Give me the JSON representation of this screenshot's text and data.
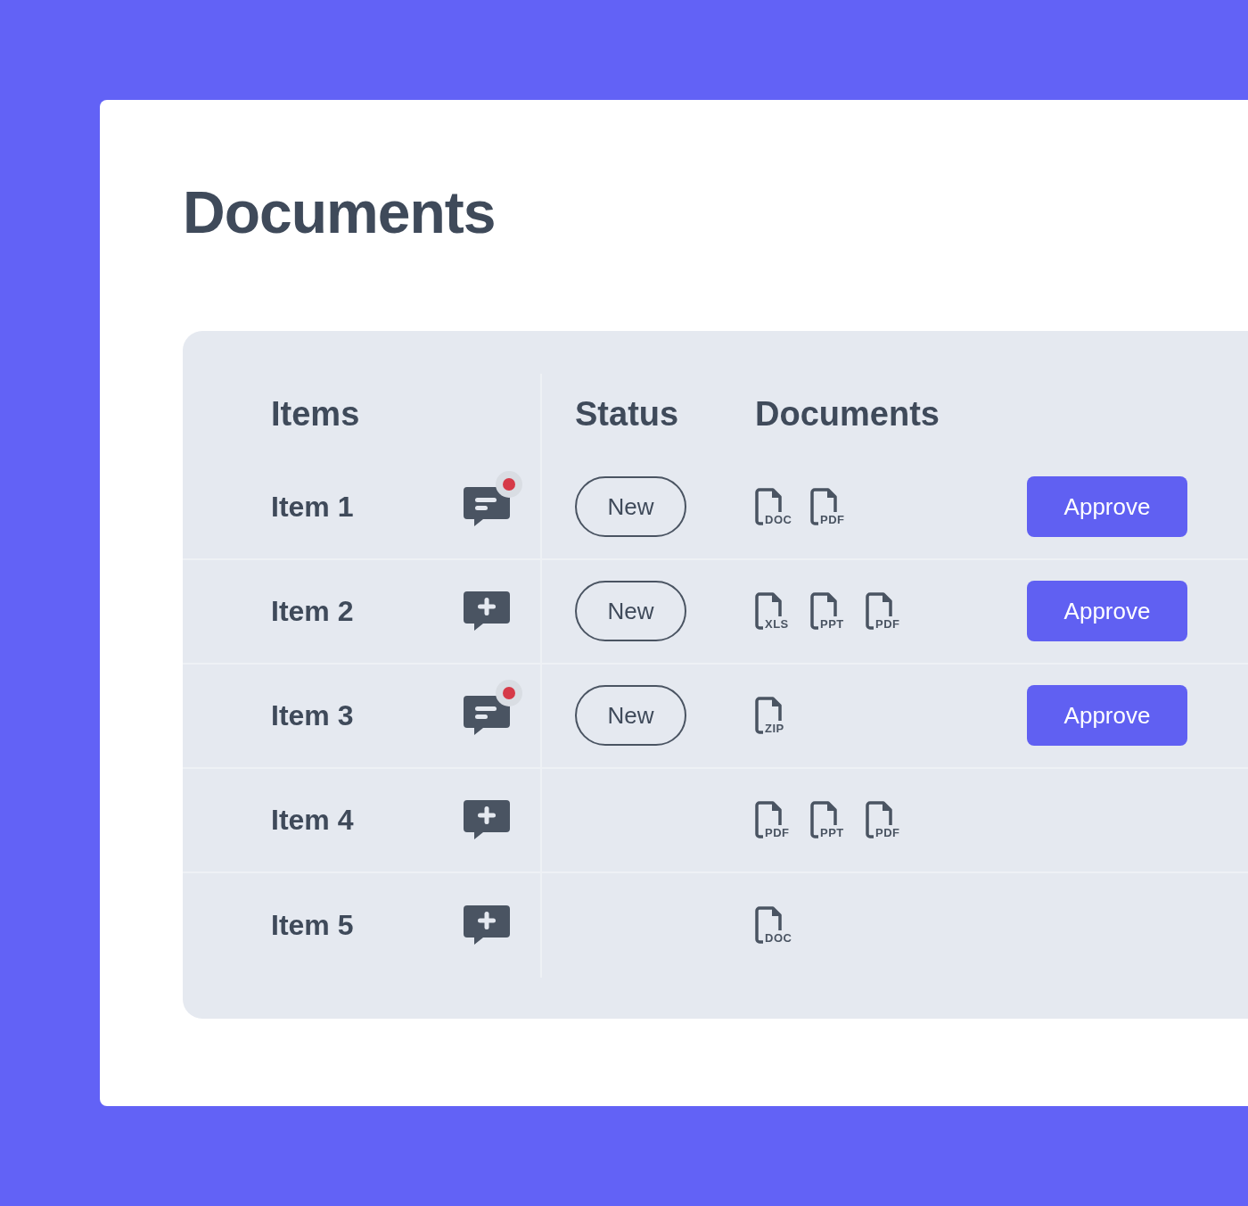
{
  "title": "Documents",
  "columns": [
    "Items",
    "Status",
    "Documents"
  ],
  "rows": [
    {
      "name": "Item 1",
      "comment": {
        "kind": "message",
        "unread": true
      },
      "status": "New",
      "files": [
        "DOC",
        "PDF"
      ],
      "action": "Approve"
    },
    {
      "name": "Item 2",
      "comment": {
        "kind": "add",
        "unread": false
      },
      "status": "New",
      "files": [
        "XLS",
        "PPT",
        "PDF"
      ],
      "action": "Approve"
    },
    {
      "name": "Item 3",
      "comment": {
        "kind": "message",
        "unread": true
      },
      "status": "New",
      "files": [
        "ZIP"
      ],
      "action": "Approve"
    },
    {
      "name": "Item 4",
      "comment": {
        "kind": "add",
        "unread": false
      },
      "files": [
        "PDF",
        "PPT",
        "PDF"
      ]
    },
    {
      "name": "Item 5",
      "comment": {
        "kind": "add",
        "unread": false
      },
      "files": [
        "DOC"
      ]
    }
  ]
}
